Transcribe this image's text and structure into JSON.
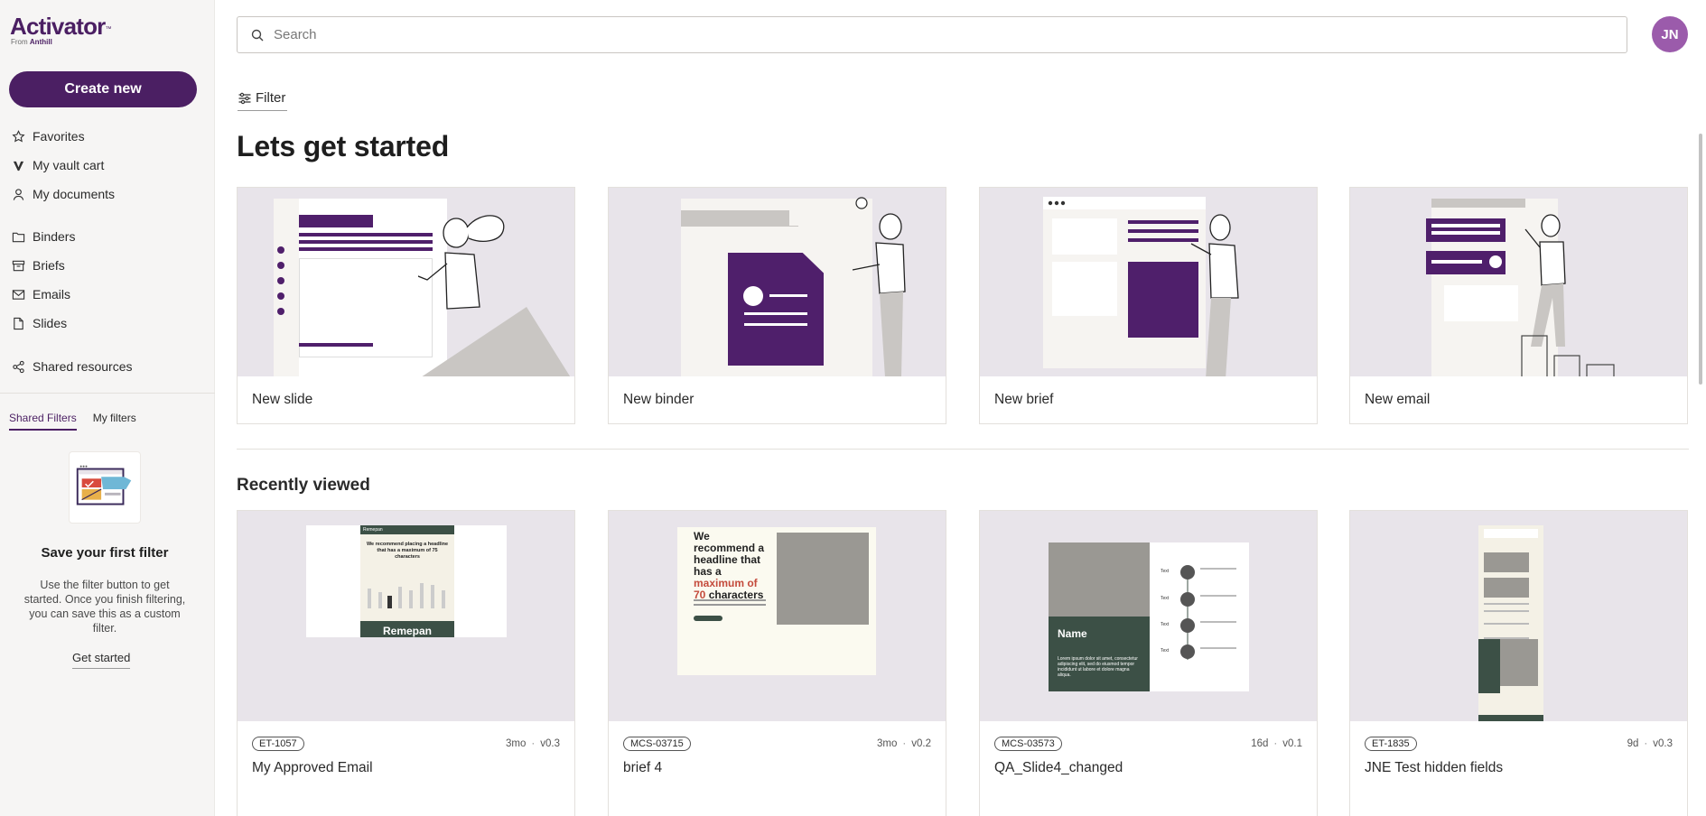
{
  "brand": {
    "name": "Activator",
    "trademark": "™",
    "sub_prefix": "From",
    "sub_company": "Anthill"
  },
  "sidebar": {
    "create_label": "Create new",
    "primary_items": [
      {
        "label": "Favorites",
        "icon": "star-icon"
      },
      {
        "label": "My vault cart",
        "icon": "vault-icon"
      },
      {
        "label": "My documents",
        "icon": "user-icon"
      }
    ],
    "secondary_items": [
      {
        "label": "Binders",
        "icon": "folder-icon"
      },
      {
        "label": "Briefs",
        "icon": "archive-icon"
      },
      {
        "label": "Emails",
        "icon": "mail-icon"
      },
      {
        "label": "Slides",
        "icon": "file-icon"
      }
    ],
    "shared_item": {
      "label": "Shared resources",
      "icon": "share-icon"
    },
    "filter_tabs": [
      {
        "label": "Shared Filters",
        "active": true
      },
      {
        "label": "My filters",
        "active": false
      }
    ],
    "empty_state": {
      "title": "Save your first filter",
      "description": "Use the filter button to get started. Once you finish filtering, you can save this as a custom filter.",
      "link_label": "Get started"
    }
  },
  "header": {
    "search_placeholder": "Search",
    "avatar_initials": "JN",
    "filter_label": "Filter"
  },
  "start": {
    "heading": "Lets get started",
    "cards": [
      {
        "label": "New slide"
      },
      {
        "label": "New binder"
      },
      {
        "label": "New brief"
      },
      {
        "label": "New email"
      }
    ]
  },
  "recent": {
    "heading": "Recently viewed",
    "cards": [
      {
        "id": "ET-1057",
        "age": "3mo",
        "version": "v0.3",
        "title": "My Approved Email"
      },
      {
        "id": "MCS-03715",
        "age": "3mo",
        "version": "v0.2",
        "title": "brief 4"
      },
      {
        "id": "MCS-03573",
        "age": "16d",
        "version": "v0.1",
        "title": "QA_Slide4_changed"
      },
      {
        "id": "ET-1835",
        "age": "9d",
        "version": "v0.3",
        "title": "JNE Test hidden fields"
      }
    ],
    "thumb_text": {
      "email_brand": "Remepan",
      "email_headline": "We recommend placing a headline that has a maximum of 75 characters",
      "brief_headline_a": "We recommend a headline that has a",
      "brief_headline_b": "maximum of 70",
      "brief_headline_c": "characters",
      "slide_name": "Name",
      "slide_body": "Lorem ipsum dolor sit amet, consectetur adipiscing elit, sed do eiusmod tempor incididunt ut labore et dolore magna aliqua.",
      "slide_label": "Text"
    }
  },
  "colors": {
    "brand_purple": "#4b1f63",
    "avatar": "#9b5bab",
    "thumb_bg": "#e8e4ea"
  }
}
